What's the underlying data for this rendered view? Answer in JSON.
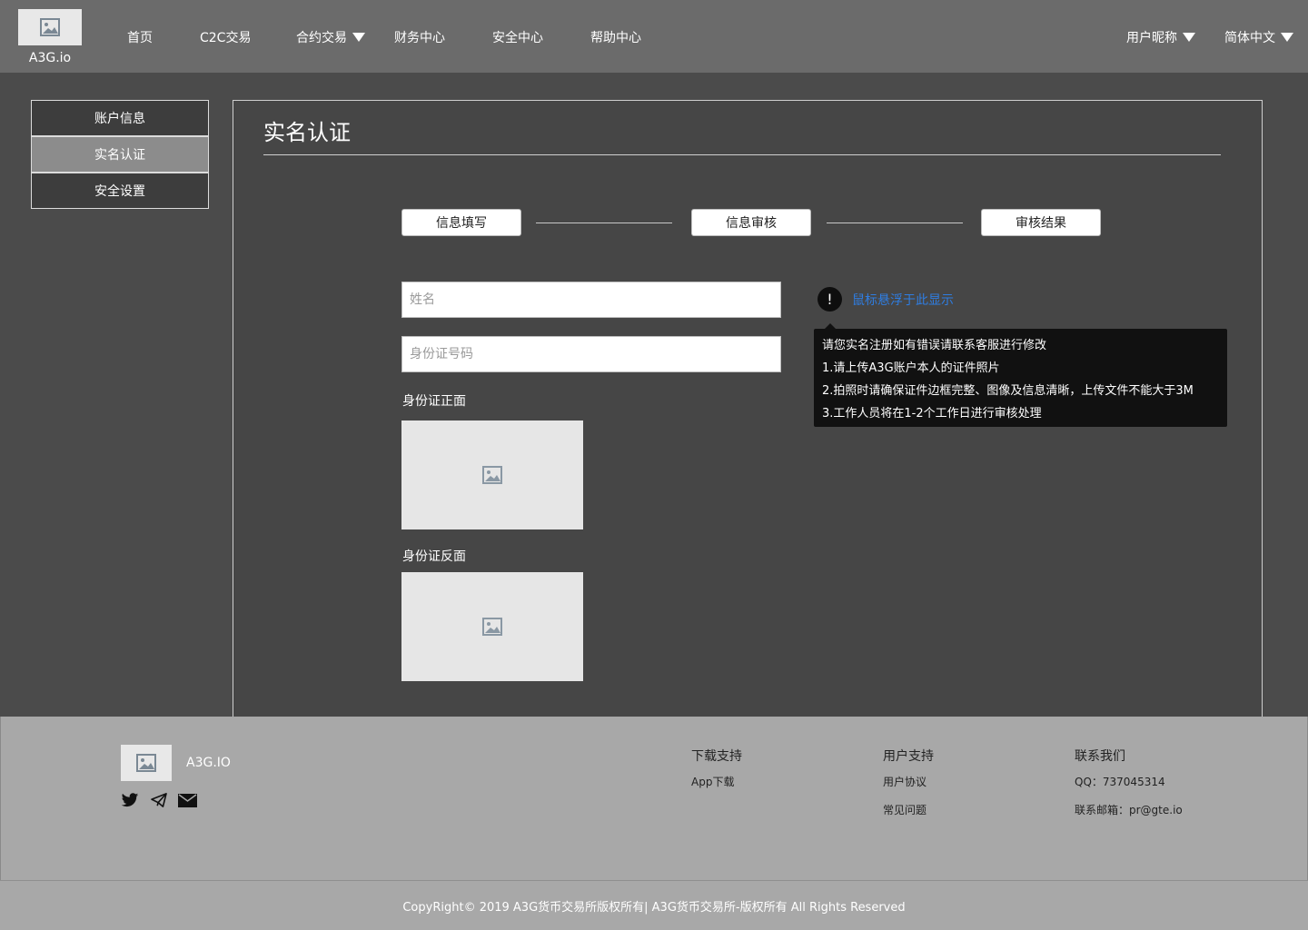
{
  "header": {
    "logo_text": "A3G.io",
    "nav": [
      "首页",
      "C2C交易",
      "合约交易",
      "财务中心",
      "安全中心",
      "帮助中心"
    ],
    "user_label": "用户昵称",
    "lang_label": "简体中文"
  },
  "sidebar": {
    "items": [
      {
        "label": "账户信息",
        "active": false
      },
      {
        "label": "实名认证",
        "active": true
      },
      {
        "label": "安全设置",
        "active": false
      }
    ]
  },
  "main": {
    "title": "实名认证",
    "steps": [
      "信息填写",
      "信息审核",
      "审核结果"
    ],
    "name_placeholder": "姓名",
    "id_placeholder": "身份证号码",
    "front_label": "身份证正面",
    "back_label": "身份证反面",
    "hover_text": "鼠标悬浮于此显示",
    "alert_symbol": "!",
    "tooltip_lines": [
      "请您实名注册如有错误请联系客服进行修改",
      "1.请上传A3G账户本人的证件照片",
      "2.拍照时请确保证件边框完整、图像及信息清晰，上传文件不能大于3M",
      "3.工作人员将在1-2个工作日进行审核处理"
    ],
    "link_color": "#2f7de1"
  },
  "footer": {
    "brand": "A3G.IO",
    "columns": [
      {
        "heading": "下载支持",
        "items": [
          "App下载"
        ]
      },
      {
        "heading": "用户支持",
        "items": [
          "用户协议",
          "常见问题"
        ]
      },
      {
        "heading": "联系我们",
        "items": [
          "QQ：737045314",
          "联系邮箱：pr@gte.io"
        ]
      }
    ],
    "copyright": "CopyRight© 2019 A3G货币交易所版权所有| A3G货币交易所-版权所有 All Rights Reserved"
  }
}
